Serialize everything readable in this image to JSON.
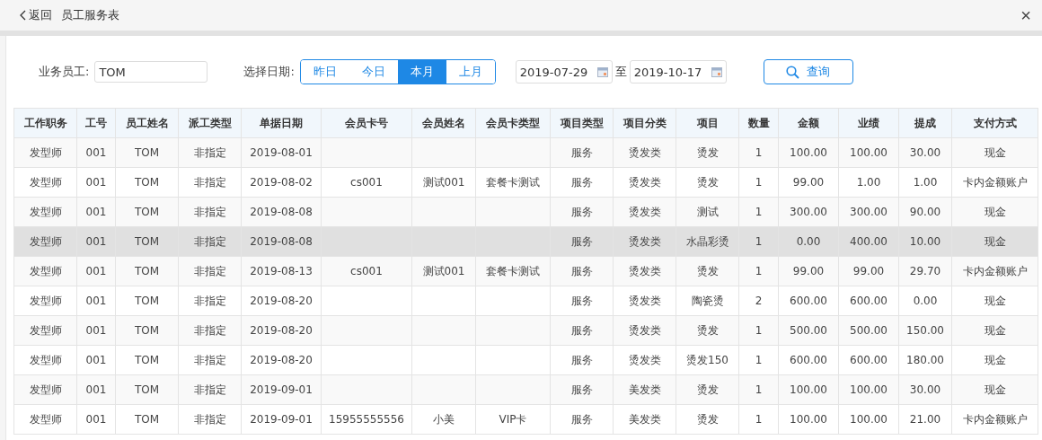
{
  "header": {
    "back": "返回",
    "title": "员工服务表",
    "close": "×"
  },
  "filters": {
    "staff_label": "业务员工:",
    "staff_value": "TOM",
    "date_label": "选择日期:",
    "ranges": [
      {
        "label": "昨日",
        "selected": false
      },
      {
        "label": "今日",
        "selected": false
      },
      {
        "label": "本月",
        "selected": true
      },
      {
        "label": "上月",
        "selected": false
      }
    ],
    "date_from": "2019-07-29",
    "date_sep": "至",
    "date_to": "2019-10-17",
    "query": "查询"
  },
  "table": {
    "columns": [
      "工作职务",
      "工号",
      "员工姓名",
      "派工类型",
      "单据日期",
      "会员卡号",
      "会员姓名",
      "会员卡类型",
      "项目类型",
      "项目分类",
      "项目",
      "数量",
      "金额",
      "业绩",
      "提成",
      "支付方式"
    ],
    "rows": [
      {
        "selected": false,
        "cells": [
          "发型师",
          "001",
          "TOM",
          "非指定",
          "2019-08-01",
          "",
          "",
          "",
          "服务",
          "烫发类",
          "烫发",
          "1",
          "100.00",
          "100.00",
          "30.00",
          "现金"
        ]
      },
      {
        "selected": false,
        "cells": [
          "发型师",
          "001",
          "TOM",
          "非指定",
          "2019-08-02",
          "cs001",
          "测试001",
          "套餐卡测试",
          "服务",
          "烫发类",
          "烫发",
          "1",
          "99.00",
          "1.00",
          "1.00",
          "卡内金额账户"
        ]
      },
      {
        "selected": false,
        "cells": [
          "发型师",
          "001",
          "TOM",
          "非指定",
          "2019-08-08",
          "",
          "",
          "",
          "服务",
          "烫发类",
          "测试",
          "1",
          "300.00",
          "300.00",
          "90.00",
          "现金"
        ]
      },
      {
        "selected": true,
        "cells": [
          "发型师",
          "001",
          "TOM",
          "非指定",
          "2019-08-08",
          "",
          "",
          "",
          "服务",
          "烫发类",
          "水晶彩烫",
          "1",
          "0.00",
          "400.00",
          "10.00",
          "现金"
        ]
      },
      {
        "selected": false,
        "cells": [
          "发型师",
          "001",
          "TOM",
          "非指定",
          "2019-08-13",
          "cs001",
          "测试001",
          "套餐卡测试",
          "服务",
          "烫发类",
          "烫发",
          "1",
          "99.00",
          "99.00",
          "29.70",
          "卡内金额账户"
        ]
      },
      {
        "selected": false,
        "cells": [
          "发型师",
          "001",
          "TOM",
          "非指定",
          "2019-08-20",
          "",
          "",
          "",
          "服务",
          "烫发类",
          "陶瓷烫",
          "2",
          "600.00",
          "600.00",
          "0.00",
          "现金"
        ]
      },
      {
        "selected": false,
        "cells": [
          "发型师",
          "001",
          "TOM",
          "非指定",
          "2019-08-20",
          "",
          "",
          "",
          "服务",
          "烫发类",
          "烫发",
          "1",
          "500.00",
          "500.00",
          "150.00",
          "现金"
        ]
      },
      {
        "selected": false,
        "cells": [
          "发型师",
          "001",
          "TOM",
          "非指定",
          "2019-08-20",
          "",
          "",
          "",
          "服务",
          "烫发类",
          "烫发150",
          "1",
          "600.00",
          "600.00",
          "180.00",
          "现金"
        ]
      },
      {
        "selected": false,
        "cells": [
          "发型师",
          "001",
          "TOM",
          "非指定",
          "2019-09-01",
          "",
          "",
          "",
          "服务",
          "美发类",
          "烫发",
          "1",
          "100.00",
          "100.00",
          "30.00",
          "现金"
        ]
      },
      {
        "selected": false,
        "cells": [
          "发型师",
          "001",
          "TOM",
          "非指定",
          "2019-09-01",
          "15955555556",
          "小美",
          "VIP卡",
          "服务",
          "美发类",
          "烫发",
          "1",
          "100.00",
          "100.00",
          "21.00",
          "卡内金额账户"
        ]
      }
    ]
  }
}
